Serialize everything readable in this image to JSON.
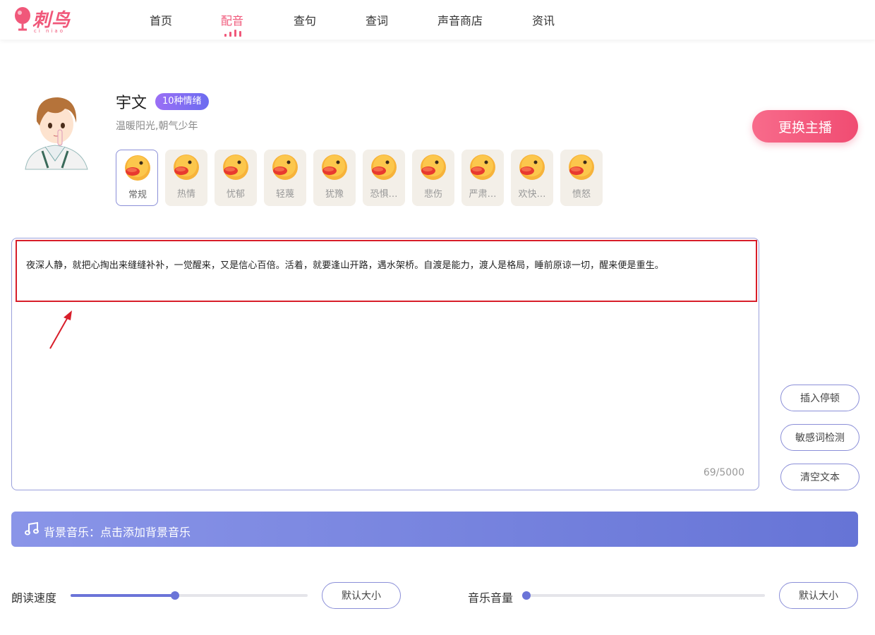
{
  "header": {
    "logo_text": "刺鸟",
    "logo_sub": "ci niao",
    "nav": [
      {
        "label": "首页",
        "active": false
      },
      {
        "label": "配音",
        "active": true
      },
      {
        "label": "查句",
        "active": false
      },
      {
        "label": "查词",
        "active": false
      },
      {
        "label": "声音商店",
        "active": false
      },
      {
        "label": "资讯",
        "active": false
      }
    ]
  },
  "anchor": {
    "name": "宇文",
    "badge": "10种情绪",
    "description": "温暖阳光,朝气少年",
    "change_button": "更换主播"
  },
  "emotions": [
    {
      "label": "常规",
      "selected": true,
      "icon": "duck-emoji-icon"
    },
    {
      "label": "热情",
      "selected": false,
      "icon": "duck-emoji-icon"
    },
    {
      "label": "忧郁",
      "selected": false,
      "icon": "duck-emoji-icon"
    },
    {
      "label": "轻蔑",
      "selected": false,
      "icon": "duck-emoji-icon"
    },
    {
      "label": "犹豫",
      "selected": false,
      "icon": "duck-emoji-icon"
    },
    {
      "label": "恐惧…",
      "selected": false,
      "icon": "duck-emoji-icon"
    },
    {
      "label": "悲伤",
      "selected": false,
      "icon": "duck-emoji-icon"
    },
    {
      "label": "严肃…",
      "selected": false,
      "icon": "duck-emoji-icon"
    },
    {
      "label": "欢快…",
      "selected": false,
      "icon": "duck-emoji-icon"
    },
    {
      "label": "愤怒",
      "selected": false,
      "icon": "duck-emoji-icon"
    }
  ],
  "editor": {
    "text": "夜深人静，就把心掏出来缝缝补补，一觉醒来，又是信心百倍。活着，就要逢山开路，遇水架桥。自渡是能力，渡人是格局，睡前原谅一切，醒来便是重生。",
    "counter": "69/5000"
  },
  "side_buttons": {
    "insert_pause": "插入停顿",
    "sensitive_check": "敏感词检测",
    "clear_text": "清空文本"
  },
  "music": {
    "label": "背景音乐：点击添加背景音乐",
    "icon": "music-note-icon"
  },
  "speed": {
    "label": "朗读速度",
    "value_fraction": 0.44,
    "default_button": "默认大小"
  },
  "volume": {
    "label": "音乐音量",
    "value_fraction": 0.0,
    "default_button": "默认大小"
  },
  "colors": {
    "brand": "#f0587a",
    "accent": "#6b74d8",
    "annotation": "#d81e2a"
  }
}
